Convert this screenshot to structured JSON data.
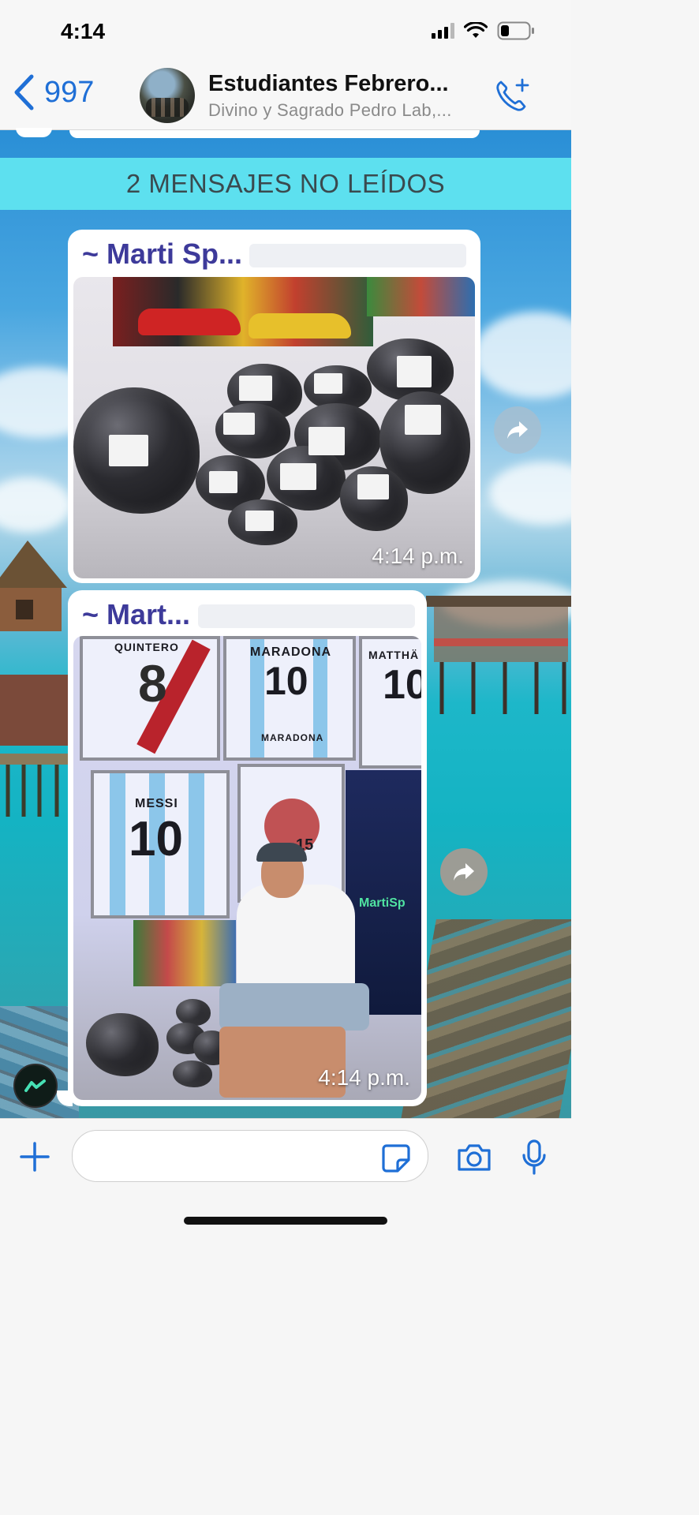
{
  "status_bar": {
    "time": "4:14"
  },
  "header": {
    "back_count": "997",
    "title": "Estudiantes Febrero...",
    "subtitle": "Divino y Sagrado Pedro Lab,..."
  },
  "chat": {
    "unread_banner": "2 MENSAJES NO LEÍDOS",
    "messages": [
      {
        "sender": "~ Marti Sp...",
        "time": "4:14 p.m.",
        "type": "photo"
      },
      {
        "sender": "~ Mart...",
        "time": "4:14 p.m.",
        "type": "photo"
      }
    ],
    "photo2_text": {
      "jersey_top_left": "QUINTERO",
      "jersey_top_center": "MARADONA",
      "jersey_top_center_number": "10",
      "jersey_top_center_bottom": "MARADONA",
      "jersey_top_right": "MATTHÄ",
      "jersey_top_right_number": "10",
      "jersey_messi": "MESSI",
      "jersey_messi_number": "10",
      "jersey_raptors_number": "15",
      "poster_text": "MartiSp"
    }
  },
  "icons": {
    "back": "chevron-left-icon",
    "call": "phone-add-icon",
    "forward": "forward-arrow-icon",
    "plus": "plus-icon",
    "sticker": "sticker-icon",
    "camera": "camera-icon",
    "mic": "microphone-icon"
  },
  "colors": {
    "accent": "#1f6fd6",
    "sender": "#3d3a9a",
    "unread_banner": "#5de0ef"
  }
}
